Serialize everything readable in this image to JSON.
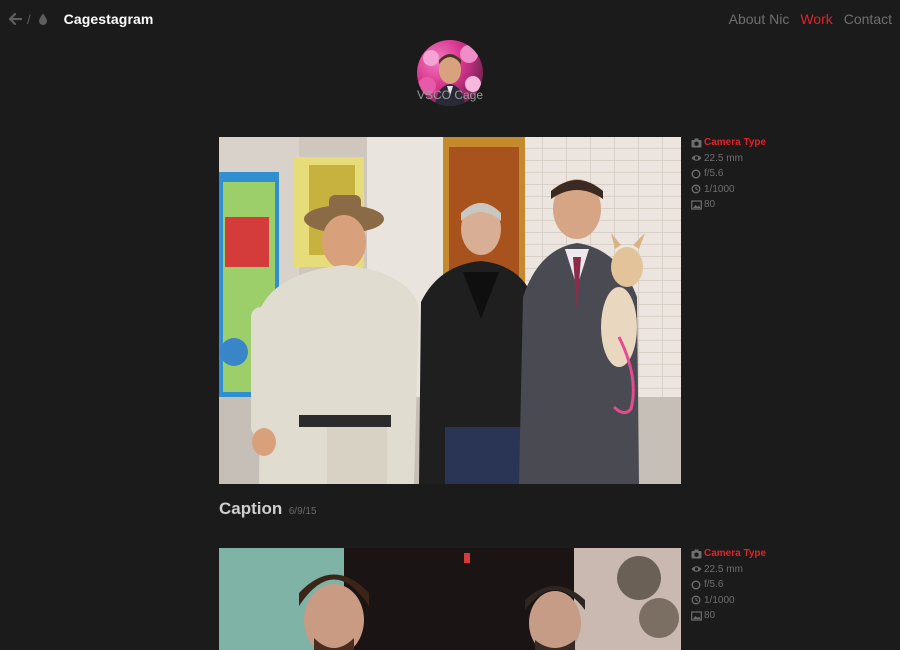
{
  "nav": {
    "brand": "Cagestagram",
    "links": [
      {
        "label": "About Nic",
        "active": false
      },
      {
        "label": "Work",
        "active": true
      },
      {
        "label": "Contact",
        "active": false
      }
    ]
  },
  "profile": {
    "name": "VSCO Cage"
  },
  "posts": [
    {
      "camera_type": "Camera Type",
      "focal_length": "22.5 mm",
      "aperture": "f/5.6",
      "shutter": "1/1000",
      "iso": "80",
      "caption": "Caption",
      "date": "6/9/15"
    },
    {
      "camera_type": "Camera Type",
      "focal_length": "22.5 mm",
      "aperture": "f/5.6",
      "shutter": "1/1000",
      "iso": "80"
    }
  ],
  "colors": {
    "background": "#1b1b1b",
    "accent": "#e0232b",
    "muted": "#6f6f6f",
    "brand_text": "#ffffff"
  },
  "icons": {
    "back": "arrow-left-icon",
    "drop": "drop-icon",
    "camera": "camera-icon",
    "eye": "eye-icon",
    "aperture": "circle-icon",
    "clock": "clock-icon",
    "image": "image-icon"
  }
}
